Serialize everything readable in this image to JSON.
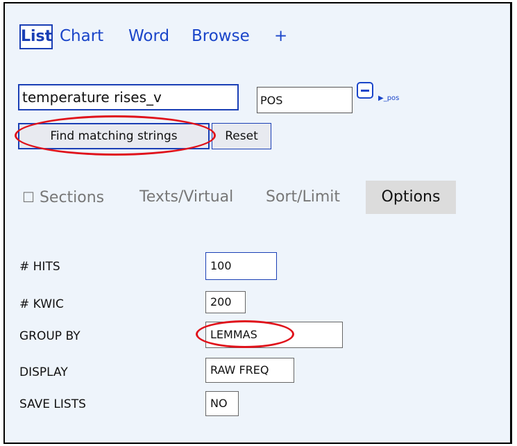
{
  "tabs": [
    {
      "label": "List",
      "active": true
    },
    {
      "label": "Chart"
    },
    {
      "label": "Word"
    },
    {
      "label": "Browse"
    },
    {
      "label": "+"
    }
  ],
  "query": {
    "search_value": "temperature rises_v",
    "pos_value": "POS",
    "pos_hint": "_pos",
    "find_button": "Find matching strings",
    "reset_button": "Reset"
  },
  "subnav": {
    "checkbox_symbol": "☐",
    "sections": "Sections",
    "texts": "Texts/Virtual",
    "sort": "Sort/Limit",
    "options": "Options"
  },
  "options": [
    {
      "label": "# HITS",
      "value": "100"
    },
    {
      "label": "# KWIC",
      "value": "200"
    },
    {
      "label": "GROUP BY",
      "value": "LEMMAS"
    },
    {
      "label": "DISPLAY",
      "value": "RAW FREQ"
    },
    {
      "label": "SAVE LISTS",
      "value": "NO"
    }
  ],
  "colors": {
    "link": "#1a45c9",
    "panel_bg": "#eef4fb",
    "highlight_red": "#e0121b"
  },
  "icons": {
    "minus": "minus-square-icon",
    "pos_arrow": "triangle-right-icon"
  }
}
